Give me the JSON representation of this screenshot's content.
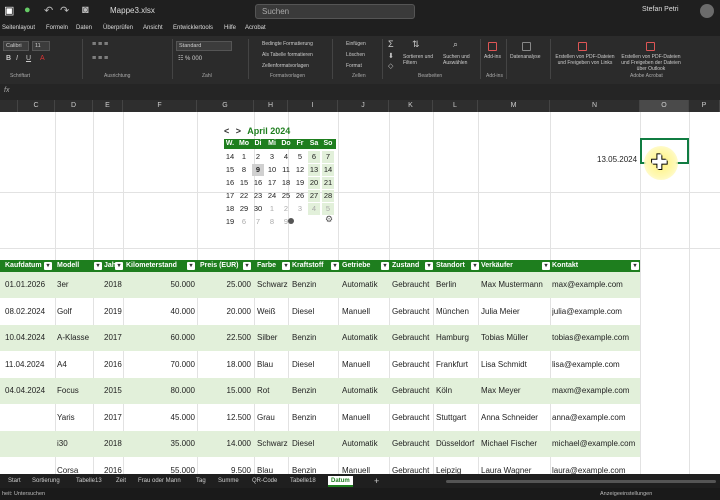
{
  "app": {
    "doc_name": "Mappe3.xlsx",
    "search_placeholder": "Suchen",
    "user": "Stefan Petri"
  },
  "menu": [
    "Seitenlayout",
    "Formeln",
    "Daten",
    "Überprüfen",
    "Ansicht",
    "Entwicklertools",
    "Hilfe",
    "Acrobat"
  ],
  "ribbon": {
    "font_name": "Calibri",
    "font_size": "11",
    "number_format": "Standard",
    "cond_format": "Bedingte Formatierung",
    "as_table": "Als Tabelle formatieren",
    "cell_styles": "Zellenformatvorlagen",
    "insert": "Einfügen",
    "delete": "Löschen",
    "format": "Format",
    "sort_filter": "Sortieren und Filtern",
    "find_select": "Suchen und Auswählen",
    "addins": "Add-ins",
    "data_analysis": "Datenanalyse",
    "pdf_create": "Erstellen von PDF-Dateien und Freigeben von Links",
    "pdf_outlook": "Erstellen von PDF-Dateien und Freigeben der Dateien über Outlook",
    "groups": [
      "Schriftart",
      "Ausrichtung",
      "Zahl",
      "Formatvorlagen",
      "Zellen",
      "Bearbeiten",
      "Add-ins",
      "Adobe Acrobat"
    ]
  },
  "formula_label": "fx",
  "columns": [
    "C",
    "D",
    "E",
    "F",
    "G",
    "H",
    "I",
    "J",
    "K",
    "L",
    "M",
    "N",
    "O",
    "P"
  ],
  "calendar": {
    "prev": "<",
    "next": ">",
    "month": "April 2024",
    "headers": [
      "W.",
      "Mo",
      "Di",
      "Mi",
      "Do",
      "Fr",
      "Sa",
      "So"
    ],
    "rows": [
      [
        "14",
        "1",
        "2",
        "3",
        "4",
        "5",
        "6",
        "7"
      ],
      [
        "15",
        "8",
        "9",
        "10",
        "11",
        "12",
        "13",
        "14"
      ],
      [
        "16",
        "15",
        "16",
        "17",
        "18",
        "19",
        "20",
        "21"
      ],
      [
        "17",
        "22",
        "23",
        "24",
        "25",
        "26",
        "27",
        "28"
      ],
      [
        "18",
        "29",
        "30",
        "1",
        "2",
        "3",
        "4",
        "5"
      ],
      [
        "19",
        "6",
        "7",
        "8",
        "9",
        "",
        "",
        ""
      ]
    ]
  },
  "date_cell": "13.05.2024",
  "table": {
    "headers": [
      "Kaufdatum",
      "Modell",
      "Jahr",
      "Kilometerstand",
      "Preis (EUR)",
      "Farbe",
      "Kraftstoff",
      "Getriebe",
      "Zustand",
      "Standort",
      "Verkäufer",
      "Kontakt"
    ],
    "rows": [
      [
        "01.01.2026",
        "3er",
        "2018",
        "50.000",
        "25.000",
        "Schwarz",
        "Benzin",
        "Automatik",
        "Gebraucht",
        "Berlin",
        "Max Mustermann",
        "max@example.com"
      ],
      [
        "08.02.2024",
        "Golf",
        "2019",
        "40.000",
        "20.000",
        "Weiß",
        "Diesel",
        "Manuell",
        "Gebraucht",
        "München",
        "Julia Meier",
        "julia@example.com"
      ],
      [
        "10.04.2024",
        "A-Klasse",
        "2017",
        "60.000",
        "22.500",
        "Silber",
        "Benzin",
        "Automatik",
        "Gebraucht",
        "Hamburg",
        "Tobias Müller",
        "tobias@example.com"
      ],
      [
        "11.04.2024",
        "A4",
        "2016",
        "70.000",
        "18.000",
        "Blau",
        "Diesel",
        "Manuell",
        "Gebraucht",
        "Frankfurt",
        "Lisa Schmidt",
        "lisa@example.com"
      ],
      [
        "04.04.2024",
        "Focus",
        "2015",
        "80.000",
        "15.000",
        "Rot",
        "Benzin",
        "Automatik",
        "Gebraucht",
        "Köln",
        "Max Meyer",
        "maxm@example.com"
      ],
      [
        "",
        "Yaris",
        "2017",
        "45.000",
        "12.500",
        "Grau",
        "Benzin",
        "Manuell",
        "Gebraucht",
        "Stuttgart",
        "Anna Schneider",
        "anna@example.com"
      ],
      [
        "",
        "i30",
        "2018",
        "35.000",
        "14.000",
        "Schwarz",
        "Diesel",
        "Automatik",
        "Gebraucht",
        "Düsseldorf",
        "Michael Fischer",
        "michael@example.com"
      ],
      [
        "",
        "Corsa",
        "2016",
        "55.000",
        "9.500",
        "Blau",
        "Benzin",
        "Manuell",
        "Gebraucht",
        "Leipzig",
        "Laura Wagner",
        "laura@example.com"
      ]
    ]
  },
  "tabs": [
    "Start",
    "Sortierung",
    "Tabelle13",
    "Zeit",
    "Frau oder Mann",
    "Tag",
    "Summe",
    "QR-Code",
    "Tabelle18",
    "Datum"
  ],
  "status": {
    "left": "heit: Untersuchen",
    "right": "Anzeigeeinstellungen"
  }
}
